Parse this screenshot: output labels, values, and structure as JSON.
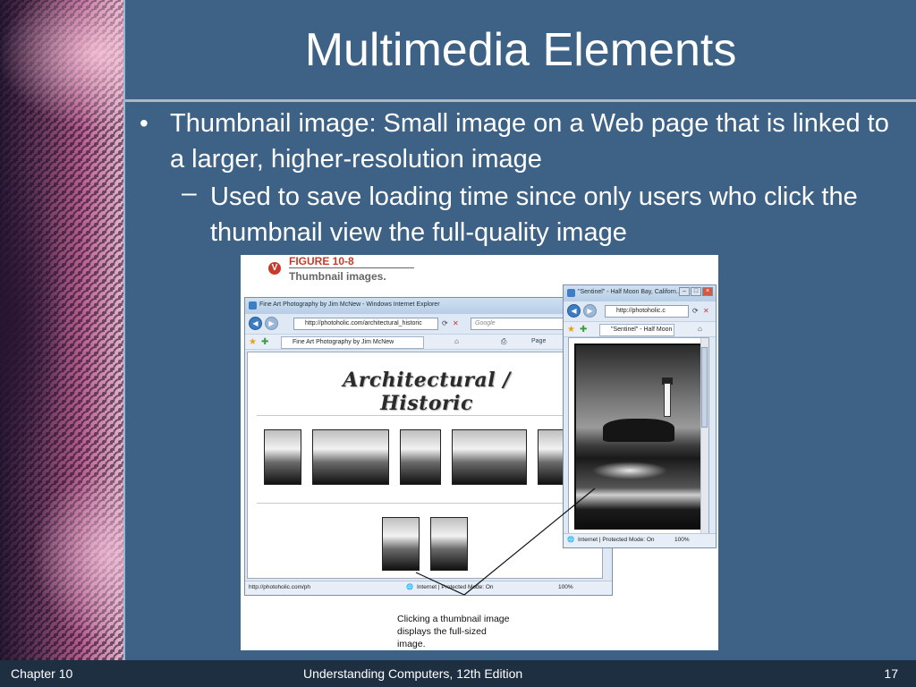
{
  "slide": {
    "title": "Multimedia Elements",
    "bullet": "Thumbnail image: Small image on a Web page that is linked to a larger, higher-resolution image",
    "bullet_marker": "•",
    "sub_marker": "–",
    "sub_bullet": "Used to save loading time since only users who click the thumbnail view the full-quality image"
  },
  "figure": {
    "badge": "V",
    "label": "FIGURE 10-8",
    "caption": "Thumbnail images.",
    "callout": "Clicking a thumbnail image displays the full-sized image.",
    "browser_main": {
      "title": "Fine Art Photography by Jim McNew - Windows Internet Explorer",
      "address": "http://photoholic.com/architectural_historic",
      "search_placeholder": "Google",
      "tab_label": "Fine Art Photography by Jim McNew",
      "toolbar_page": "Page",
      "page_heading": "Architectural / Historic",
      "status_url": "http://photoholic.com/ph",
      "status_zone": "Internet | Protected Mode: On",
      "zoom": "100%"
    },
    "browser_popup": {
      "title": "\"Sentinel\" - Half Moon Bay, Californ...",
      "address": "http://photoholic.c",
      "tab_label": "\"Sentinel\" - Half Moon ...",
      "status_zone": "Internet | Protected Mode: On",
      "zoom": "100%"
    }
  },
  "footer": {
    "chapter": "Chapter 10",
    "book": "Understanding Computers, 12th Edition",
    "page": "17"
  },
  "colors": {
    "slide_background": "#3d6285",
    "footer_background": "#1f2f42",
    "figure_accent": "#c63b2c"
  },
  "icons": {
    "back": "back-arrow-icon",
    "forward": "forward-arrow-icon",
    "refresh": "refresh-icon",
    "stop": "stop-icon",
    "favorites": "star-icon",
    "add_favorite": "add-favorite-icon",
    "home": "home-icon",
    "print": "printer-icon"
  }
}
